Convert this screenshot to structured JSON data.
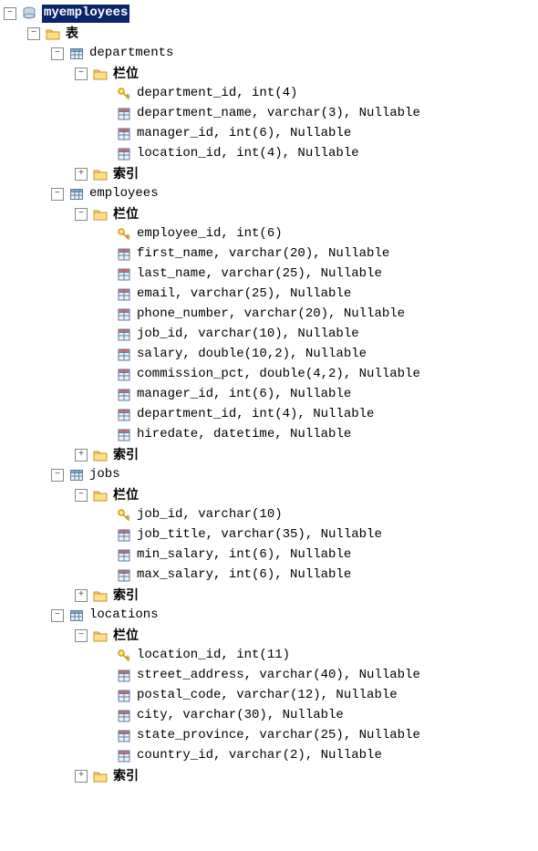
{
  "database": {
    "name": "myemployees",
    "tables_folder_label": "表",
    "tables": [
      {
        "name": "departments",
        "columns_label": "栏位",
        "indexes_label": "索引",
        "columns": [
          {
            "pk": true,
            "text": "department_id, int(4)"
          },
          {
            "pk": false,
            "text": "department_name, varchar(3), Nullable"
          },
          {
            "pk": false,
            "text": "manager_id, int(6), Nullable"
          },
          {
            "pk": false,
            "text": "location_id, int(4), Nullable"
          }
        ]
      },
      {
        "name": "employees",
        "columns_label": "栏位",
        "indexes_label": "索引",
        "columns": [
          {
            "pk": true,
            "text": "employee_id, int(6)"
          },
          {
            "pk": false,
            "text": "first_name, varchar(20), Nullable"
          },
          {
            "pk": false,
            "text": "last_name, varchar(25), Nullable"
          },
          {
            "pk": false,
            "text": "email, varchar(25), Nullable"
          },
          {
            "pk": false,
            "text": "phone_number, varchar(20), Nullable"
          },
          {
            "pk": false,
            "text": "job_id, varchar(10), Nullable"
          },
          {
            "pk": false,
            "text": "salary, double(10,2), Nullable"
          },
          {
            "pk": false,
            "text": "commission_pct, double(4,2), Nullable"
          },
          {
            "pk": false,
            "text": "manager_id, int(6), Nullable"
          },
          {
            "pk": false,
            "text": "department_id, int(4), Nullable"
          },
          {
            "pk": false,
            "text": "hiredate, datetime, Nullable"
          }
        ]
      },
      {
        "name": "jobs",
        "columns_label": "栏位",
        "indexes_label": "索引",
        "columns": [
          {
            "pk": true,
            "text": "job_id, varchar(10)"
          },
          {
            "pk": false,
            "text": "job_title, varchar(35), Nullable"
          },
          {
            "pk": false,
            "text": "min_salary, int(6), Nullable"
          },
          {
            "pk": false,
            "text": "max_salary, int(6), Nullable"
          }
        ]
      },
      {
        "name": "locations",
        "columns_label": "栏位",
        "indexes_label": "索引",
        "columns": [
          {
            "pk": true,
            "text": "location_id, int(11)"
          },
          {
            "pk": false,
            "text": "street_address, varchar(40), Nullable"
          },
          {
            "pk": false,
            "text": "postal_code, varchar(12), Nullable"
          },
          {
            "pk": false,
            "text": "city, varchar(30), Nullable"
          },
          {
            "pk": false,
            "text": "state_province, varchar(25), Nullable"
          },
          {
            "pk": false,
            "text": "country_id, varchar(2), Nullable"
          }
        ]
      }
    ]
  }
}
